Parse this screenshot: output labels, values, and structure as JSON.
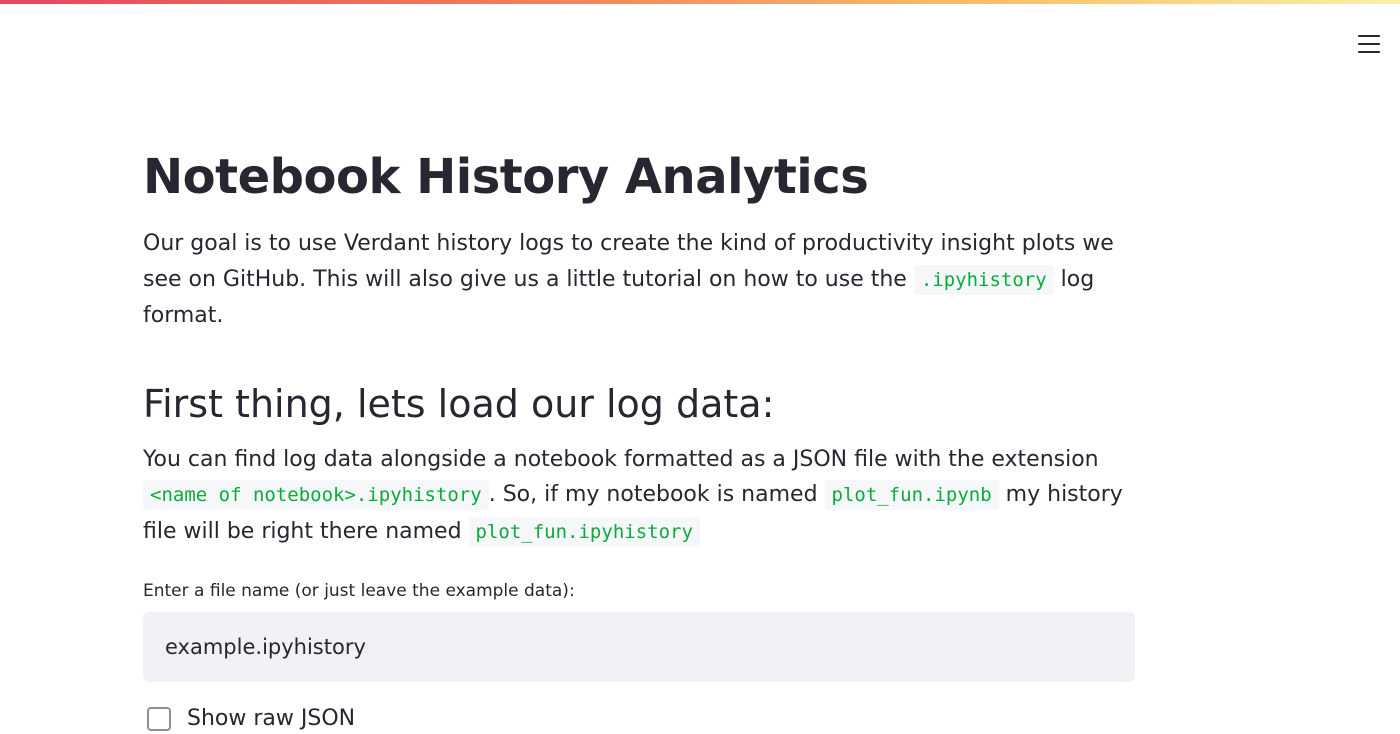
{
  "app": {
    "menu_icon": "hamburger-menu-icon",
    "accent_gradient": [
      "#e5465f",
      "#f07a5a",
      "#f4b56a",
      "#f8e08e",
      "#fbefb0"
    ]
  },
  "main": {
    "title": "Notebook History Analytics",
    "intro": {
      "text_before": "Our goal is to use Verdant history logs to create the kind of productivity insight plots we see on GitHub. This will also give us a little tutorial on how to use the ",
      "code": ".ipyhistory",
      "text_after": " log format."
    },
    "subheader": "First thing, lets load our log data:",
    "description": {
      "part1": "You can find log data alongside a notebook formatted as a JSON file with the extension ",
      "code1": "<name of notebook>.ipyhistory",
      "part2": ". So, if my notebook is named ",
      "code2": "plot_fun.ipynb",
      "part3": " my history file will be right there named ",
      "code3": "plot_fun.ipyhistory"
    },
    "file_input": {
      "label": "Enter a file name (or just leave the example data):",
      "value": "example.ipyhistory"
    },
    "raw_json_checkbox": {
      "label": "Show raw JSON",
      "checked": false
    }
  }
}
